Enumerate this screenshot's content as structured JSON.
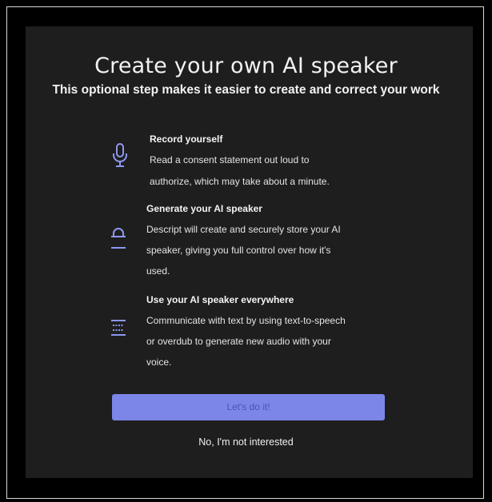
{
  "dialog": {
    "title": "Create your own AI speaker",
    "subtitle": "This optional step makes it easier to create and correct your work"
  },
  "features": [
    {
      "icon": "microphone-icon",
      "heading": "Record yourself",
      "lines": [
        "Read a consent statement out loud to",
        "authorize, which may take about a minute."
      ]
    },
    {
      "icon": "voice-speaker-icon",
      "heading": "Generate your AI speaker",
      "lines": [
        "Descript will create and securely store your AI",
        "speaker, giving you full control over how it's",
        "used."
      ]
    },
    {
      "icon": "text-lines-icon",
      "heading": "Use your AI speaker everywhere",
      "lines": [
        "Communicate with text by using text-to-speech",
        "or overdub to generate new audio with your",
        "voice."
      ]
    }
  ],
  "actions": {
    "confirm_label": "Let's do it!",
    "decline_label": "No, I'm not interested"
  },
  "colors": {
    "background": "#1e1e1e",
    "accent": "#7b86e8",
    "icon": "#8e97f0"
  }
}
